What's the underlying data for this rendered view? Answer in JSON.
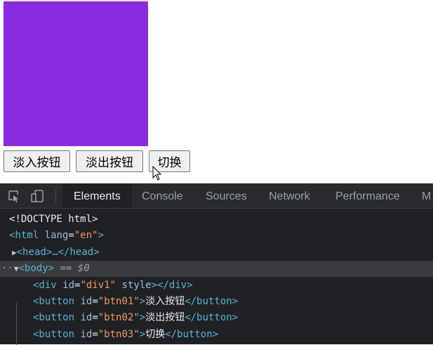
{
  "page": {
    "square_color": "#8a2be2",
    "buttons": [
      {
        "id": "btn01",
        "label": "淡入按钮"
      },
      {
        "id": "btn02",
        "label": "淡出按钮"
      },
      {
        "id": "btn03",
        "label": "切换"
      }
    ]
  },
  "devtools": {
    "tabs": [
      "Elements",
      "Console",
      "Sources",
      "Network",
      "Performance",
      "M"
    ],
    "active_tab": "Elements",
    "dom": {
      "doctype": "<!DOCTYPE html>",
      "html_open": "<html",
      "html_attr": "lang",
      "html_eq": "=",
      "html_val": "\"en\"",
      "html_close": ">",
      "head_text": "<head>…</head>",
      "body_tag": "<body>",
      "body_eq": "== $0",
      "div_open": "<div",
      "div_attr1": "id",
      "div_val1": "\"div1\"",
      "div_attr2": "style",
      "div_close": "></div>",
      "btn_open": "<button",
      "btn_attr": "id",
      "btn1_val": "\"btn01\"",
      "btn1_text": "淡入按钮",
      "btn2_val": "\"btn02\"",
      "btn2_text": "淡出按钮",
      "btn3_val": "\"btn03\"",
      "btn3_text": "切换",
      "btn_end": "</button>",
      "gt": ">",
      "eq": "="
    }
  }
}
